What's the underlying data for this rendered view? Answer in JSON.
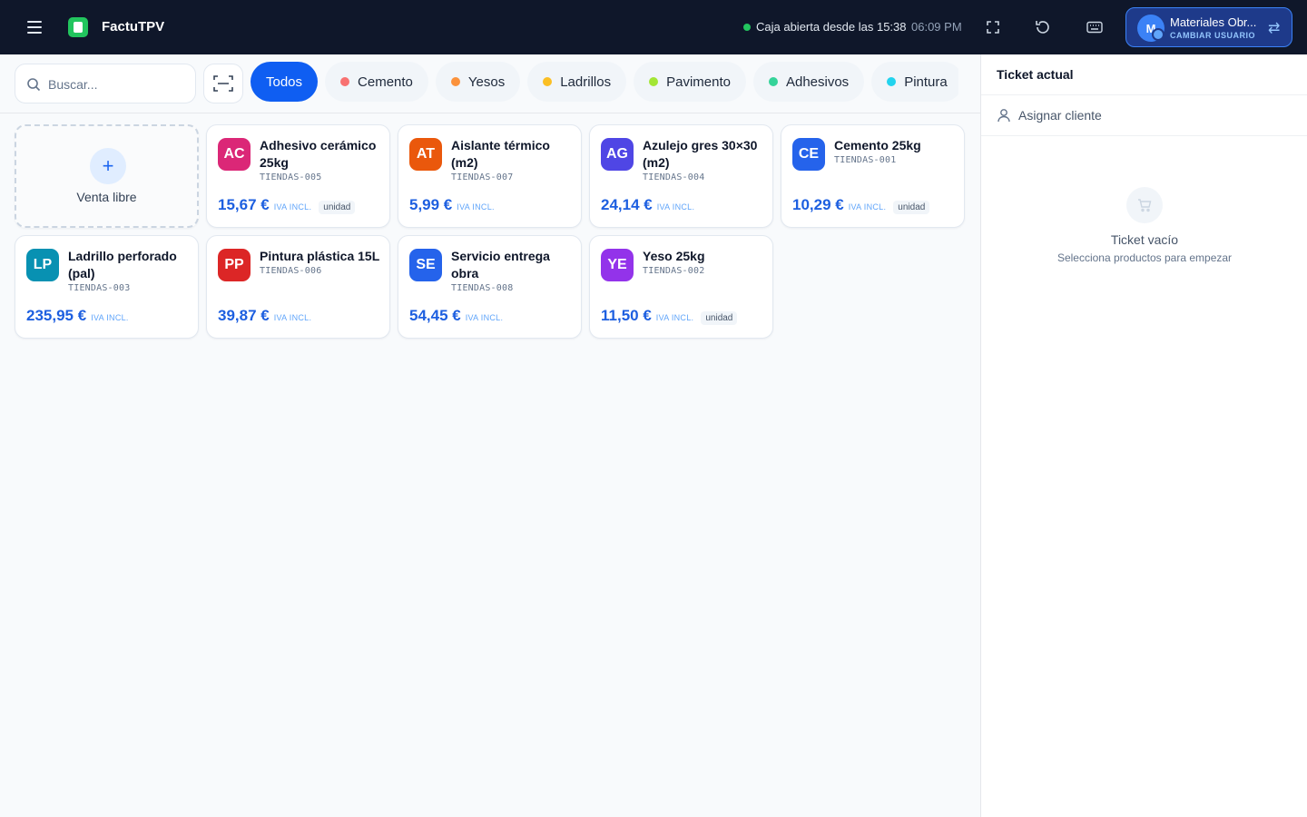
{
  "header": {
    "app_title": "FactuTPV",
    "status_text": "Caja abierta desde las 15:38",
    "time": "06:09 PM",
    "user": {
      "initial": "M",
      "name": "Materiales Obr...",
      "switch_label": "CAMBIAR USUARIO"
    }
  },
  "search": {
    "placeholder": "Buscar..."
  },
  "categories": [
    {
      "label": "Todos",
      "color": ""
    },
    {
      "label": "Cemento",
      "color": "#f87171"
    },
    {
      "label": "Yesos",
      "color": "#fb923c"
    },
    {
      "label": "Ladrillos",
      "color": "#fbbf24"
    },
    {
      "label": "Pavimento",
      "color": "#a3e635"
    },
    {
      "label": "Adhesivos",
      "color": "#34d399"
    },
    {
      "label": "Pintura",
      "color": "#22d3ee"
    }
  ],
  "free_sale": {
    "label": "Venta libre"
  },
  "products": [
    {
      "initials": "AC",
      "color": "#db2777",
      "name": "Adhesivo cerámico 25kg",
      "sku": "TIENDAS-005",
      "price": "15,67 €",
      "vat": "IVA INCL.",
      "unit": "unidad"
    },
    {
      "initials": "AT",
      "color": "#ea580c",
      "name": "Aislante térmico (m2)",
      "sku": "TIENDAS-007",
      "price": "5,99 €",
      "vat": "IVA INCL.",
      "unit": ""
    },
    {
      "initials": "AG",
      "color": "#4f46e5",
      "name": "Azulejo gres 30×30 (m2)",
      "sku": "TIENDAS-004",
      "price": "24,14 €",
      "vat": "IVA INCL.",
      "unit": ""
    },
    {
      "initials": "CE",
      "color": "#2563eb",
      "name": "Cemento 25kg",
      "sku": "TIENDAS-001",
      "price": "10,29 €",
      "vat": "IVA INCL.",
      "unit": "unidad"
    },
    {
      "initials": "LP",
      "color": "#0891b2",
      "name": "Ladrillo perforado (pal)",
      "sku": "TIENDAS-003",
      "price": "235,95 €",
      "vat": "IVA INCL.",
      "unit": ""
    },
    {
      "initials": "PP",
      "color": "#dc2626",
      "name": "Pintura plástica 15L",
      "sku": "TIENDAS-006",
      "price": "39,87 €",
      "vat": "IVA INCL.",
      "unit": ""
    },
    {
      "initials": "SE",
      "color": "#2563eb",
      "name": "Servicio entrega obra",
      "sku": "TIENDAS-008",
      "price": "54,45 €",
      "vat": "IVA INCL.",
      "unit": ""
    },
    {
      "initials": "YE",
      "color": "#9333ea",
      "name": "Yeso 25kg",
      "sku": "TIENDAS-002",
      "price": "11,50 €",
      "vat": "IVA INCL.",
      "unit": "unidad"
    }
  ],
  "ticket": {
    "title": "Ticket actual",
    "assign_label": "Asignar cliente",
    "empty_title": "Ticket vacío",
    "empty_subtitle": "Selecciona productos para empezar"
  },
  "icons": {
    "menu": "menu-icon",
    "logo": "app-logo-icon",
    "fullscreen": "fullscreen-icon",
    "refresh": "refresh-icon",
    "keyboard": "keyboard-icon",
    "swap": "swap-user-icon",
    "search": "search-icon",
    "scan": "barcode-scan-icon",
    "user": "user-icon",
    "cart": "cart-icon"
  }
}
